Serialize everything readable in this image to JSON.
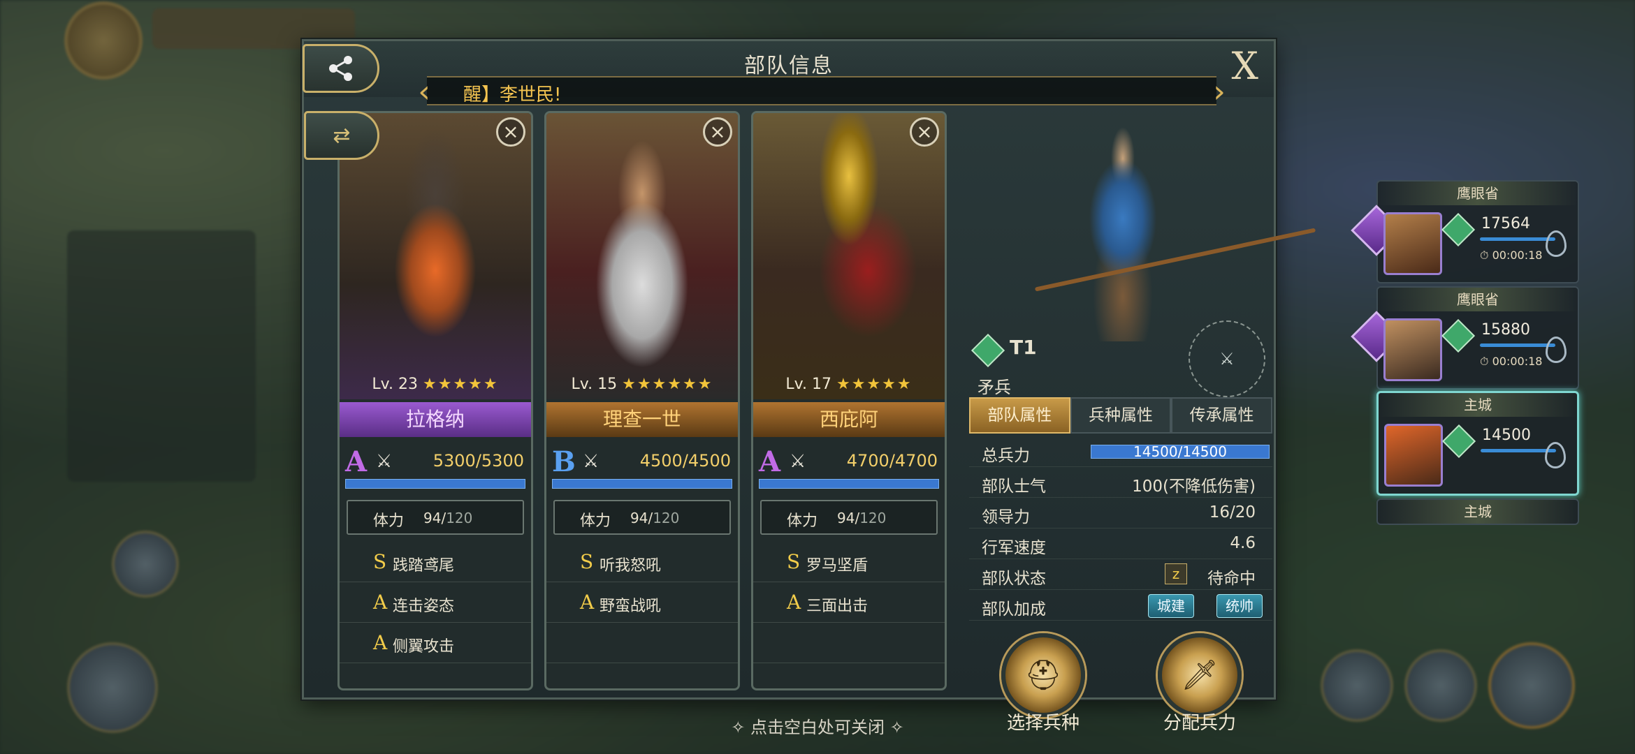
{
  "modal": {
    "title": "部队信息",
    "close_label": "X",
    "ticker": "醒】李世民!"
  },
  "heroes": [
    {
      "level": "Lv. 23",
      "stars": "★★★★★",
      "name": "拉格纳",
      "rarity_color": "purple",
      "rank": "A",
      "troops": "5300/5300",
      "stamina_label": "体力",
      "stamina": "94/",
      "stamina_max": "120",
      "skills": [
        {
          "grade": "S",
          "name": "践踏鸢尾"
        },
        {
          "grade": "A",
          "name": "连击姿态"
        },
        {
          "grade": "A",
          "name": "侧翼攻击"
        }
      ]
    },
    {
      "level": "Lv. 15",
      "stars": "★★★★★★",
      "name": "理查一世",
      "rarity_color": "orange",
      "rank": "B",
      "troops": "4500/4500",
      "stamina_label": "体力",
      "stamina": "94/",
      "stamina_max": "120",
      "skills": [
        {
          "grade": "S",
          "name": "听我怒吼"
        },
        {
          "grade": "A",
          "name": "野蛮战吼"
        }
      ]
    },
    {
      "level": "Lv. 17",
      "stars": "★★★★★",
      "name": "西庇阿",
      "rarity_color": "orange",
      "rank": "A",
      "troops": "4700/4700",
      "stamina_label": "体力",
      "stamina": "94/",
      "stamina_max": "120",
      "skills": [
        {
          "grade": "S",
          "name": "罗马坚盾"
        },
        {
          "grade": "A",
          "name": "三面出击"
        }
      ]
    }
  ],
  "unit": {
    "tier": "T1",
    "name": "矛兵",
    "tabs": [
      "部队属性",
      "兵种属性",
      "传承属性"
    ],
    "attributes": {
      "total_troops_label": "总兵力",
      "total_troops": "14500/14500",
      "morale_label": "部队士气",
      "morale": "100(不降低伤害)",
      "leadership_label": "领导力",
      "leadership": "16/20",
      "speed_label": "行军速度",
      "speed": "4.6",
      "status_label": "部队状态",
      "status": "待命中",
      "bonus_label": "部队加成",
      "bonus_tags": [
        "城建",
        "统帅"
      ]
    },
    "buttons": {
      "select_troop": "选择兵种",
      "assign_troops": "分配兵力"
    }
  },
  "armies": [
    {
      "location": "鹰眼省",
      "count": "17564",
      "timer": "00:00:18"
    },
    {
      "location": "鹰眼省",
      "count": "15880",
      "timer": "00:00:18"
    },
    {
      "location": "主城",
      "count": "14500",
      "timer": ""
    },
    {
      "location": "主城",
      "count": "",
      "timer": ""
    }
  ],
  "hint": "点击空白处可关闭"
}
